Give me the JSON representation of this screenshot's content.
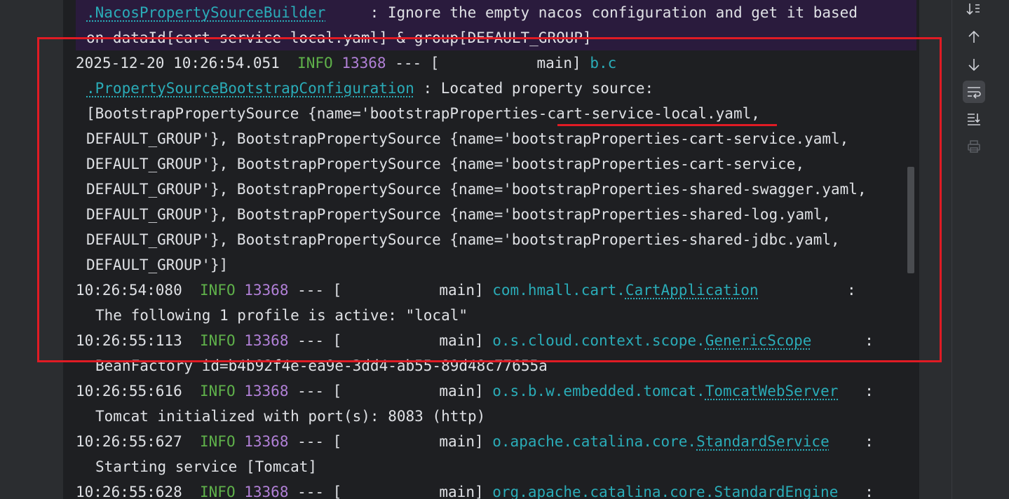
{
  "console": {
    "lines": [
      {
        "type": "cont",
        "cls": ".NacosPropertySourceBuilder",
        "rest": "     : Ignore the empty nacos configuration and get it based"
      },
      {
        "type": "cont",
        "text": "on dataId[cart-service-local.yaml] & group[DEFAULT_GROUP]"
      },
      {
        "ts": "2025-12-20 10:26:54.051",
        "level": "INFO",
        "pid": "13368",
        "mid": " --- [           main] ",
        "cls": "b.c"
      },
      {
        "type": "cont",
        "cls": ".PropertySourceBootstrapConfiguration",
        "rest": " : Located property source:"
      },
      {
        "type": "cont",
        "text": "[BootstrapPropertySource {name='bootstrapProperties-cart-service-local.yaml,"
      },
      {
        "type": "cont",
        "text": "DEFAULT_GROUP'}, BootstrapPropertySource {name='bootstrapProperties-cart-service.yaml,"
      },
      {
        "type": "cont",
        "text": "DEFAULT_GROUP'}, BootstrapPropertySource {name='bootstrapProperties-cart-service,"
      },
      {
        "type": "cont",
        "text": "DEFAULT_GROUP'}, BootstrapPropertySource {name='bootstrapProperties-shared-swagger.yaml,"
      },
      {
        "type": "cont",
        "text": "DEFAULT_GROUP'}, BootstrapPropertySource {name='bootstrapProperties-shared-log.yaml,"
      },
      {
        "type": "cont",
        "text": "DEFAULT_GROUP'}, BootstrapPropertySource {name='bootstrapProperties-shared-jdbc.yaml,"
      },
      {
        "type": "cont",
        "text": "DEFAULT_GROUP'}]"
      },
      {
        "ts": "10:26:54:080",
        "level": "INFO",
        "pid": "13368",
        "mid": " --- [           main] ",
        "pkg": "com.hmall.cart.",
        "cls": "CartApplication",
        "tail": "          :"
      },
      {
        "type": "msg",
        "text": "The following 1 profile is active: \"local\""
      },
      {
        "ts": "10:26:55:113",
        "level": "INFO",
        "pid": "13368",
        "mid": " --- [           main] ",
        "pkg": "o.s.cloud.context.scope.",
        "cls": "GenericScope",
        "tail": "      :"
      },
      {
        "type": "msg",
        "text": "BeanFactory id=b4b92f4e-ea9e-3dd4-ab55-89d48c77655a"
      },
      {
        "ts": "10:26:55:616",
        "level": "INFO",
        "pid": "13368",
        "mid": " --- [           main] ",
        "pkg": "o.s.b.w.embedded.tomcat.",
        "cls": "TomcatWebServer",
        "tail": "   :"
      },
      {
        "type": "msg",
        "text": "Tomcat initialized with port(s): 8083 (http)"
      },
      {
        "ts": "10:26:55:627",
        "level": "INFO",
        "pid": "13368",
        "mid": " --- [           main] ",
        "pkg": "o.apache.catalina.core.",
        "cls": "StandardService",
        "tail": "    :"
      },
      {
        "type": "msg",
        "text": "Starting service [Tomcat]"
      },
      {
        "ts": "10:26:55:628",
        "level": "INFO",
        "pid": "13368",
        "mid": " --- [           main] ",
        "pkg": "org.apache.catalina.core.",
        "cls": "StandardEngine",
        "tail": "   :"
      }
    ]
  },
  "toolbar": {
    "icons": [
      "sort-down-icon",
      "arrow-up-icon",
      "arrow-down-icon",
      "soft-wrap-icon",
      "scroll-to-end-icon",
      "print-icon"
    ]
  },
  "colors": {
    "info": "#5fb14a",
    "pid": "#b180d7",
    "class": "#2aacb8",
    "annotation": "#e01b24"
  }
}
